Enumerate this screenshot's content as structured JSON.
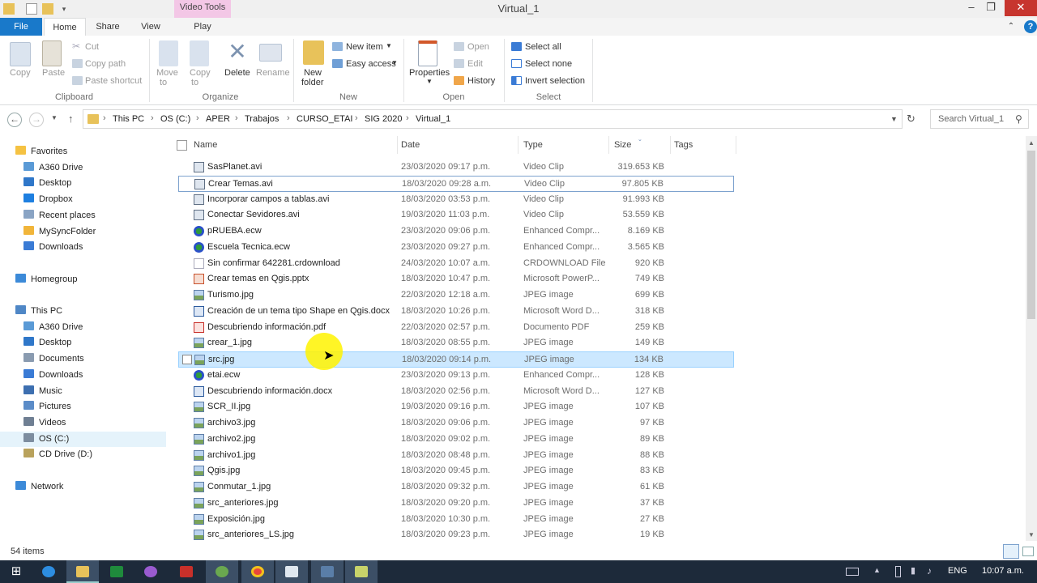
{
  "window": {
    "title": "Virtual_1",
    "context_tab": "Video Tools",
    "min": "–",
    "max": "❐",
    "close": "✕"
  },
  "ribbon_tabs": [
    "File",
    "Home",
    "Share",
    "View",
    "Play"
  ],
  "ribbon": {
    "clipboard": {
      "copy": "Copy",
      "paste": "Paste",
      "cut": "Cut",
      "copy_path": "Copy path",
      "paste_shortcut": "Paste shortcut",
      "group": "Clipboard"
    },
    "organize": {
      "move_to": "Move",
      "move_to2": "to",
      "copy_to": "Copy",
      "copy_to2": "to",
      "delete": "Delete",
      "rename": "Rename",
      "group": "Organize"
    },
    "new": {
      "new_folder": "New",
      "new_folder2": "folder",
      "new_item": "New item",
      "easy_access": "Easy access",
      "group": "New"
    },
    "open": {
      "properties": "Properties",
      "open": "Open",
      "edit": "Edit",
      "history": "History",
      "group": "Open"
    },
    "select": {
      "select_all": "Select all",
      "select_none": "Select none",
      "invert": "Invert selection",
      "group": "Select"
    }
  },
  "address": {
    "crumbs": [
      "This PC",
      "OS (C:)",
      "APER",
      "Trabajos",
      "CURSO_ETAI",
      "SIG 2020",
      "Virtual_1"
    ],
    "search_placeholder": "Search Virtual_1"
  },
  "nav": [
    {
      "label": "Favorites",
      "indent": 0,
      "icon": "star-icon",
      "color": "#f5c242"
    },
    {
      "label": "A360 Drive",
      "indent": 1,
      "icon": "cloud-icon",
      "color": "#5a9ad6"
    },
    {
      "label": "Desktop",
      "indent": 1,
      "icon": "desktop-icon",
      "color": "#2f77c9"
    },
    {
      "label": "Dropbox",
      "indent": 1,
      "icon": "dropbox-icon",
      "color": "#1e7fe0"
    },
    {
      "label": "Recent places",
      "indent": 1,
      "icon": "recent-icon",
      "color": "#8aa4c4"
    },
    {
      "label": "MySyncFolder",
      "indent": 1,
      "icon": "sync-icon",
      "color": "#f1b53a"
    },
    {
      "label": "Downloads",
      "indent": 1,
      "icon": "downloads-icon",
      "color": "#3a7bd5"
    },
    {
      "label": "",
      "indent": 0,
      "icon": "",
      "color": ""
    },
    {
      "label": "Homegroup",
      "indent": 0,
      "icon": "homegroup-icon",
      "color": "#3c8ad8"
    },
    {
      "label": "",
      "indent": 0,
      "icon": "",
      "color": ""
    },
    {
      "label": "This PC",
      "indent": 0,
      "icon": "computer-icon",
      "color": "#4f87c6"
    },
    {
      "label": "A360 Drive",
      "indent": 1,
      "icon": "cloud-icon",
      "color": "#5a9ad6"
    },
    {
      "label": "Desktop",
      "indent": 1,
      "icon": "desktop-icon",
      "color": "#2f77c9"
    },
    {
      "label": "Documents",
      "indent": 1,
      "icon": "documents-icon",
      "color": "#8a9bb0"
    },
    {
      "label": "Downloads",
      "indent": 1,
      "icon": "downloads-icon",
      "color": "#3a7bd5"
    },
    {
      "label": "Music",
      "indent": 1,
      "icon": "music-icon",
      "color": "#3d6fb0"
    },
    {
      "label": "Pictures",
      "indent": 1,
      "icon": "pictures-icon",
      "color": "#5b8cc8"
    },
    {
      "label": "Videos",
      "indent": 1,
      "icon": "videos-icon",
      "color": "#6f7f93"
    },
    {
      "label": "OS (C:)",
      "indent": 1,
      "icon": "drive-icon",
      "color": "#7d8d9f",
      "selected": true
    },
    {
      "label": "CD Drive (D:)",
      "indent": 1,
      "icon": "cd-icon",
      "color": "#b9a25c"
    },
    {
      "label": "",
      "indent": 0,
      "icon": "",
      "color": ""
    },
    {
      "label": "Network",
      "indent": 0,
      "icon": "network-icon",
      "color": "#3c8ad8"
    }
  ],
  "columns": {
    "name": "Name",
    "date": "Date",
    "type": "Type",
    "size": "Size",
    "tags": "Tags"
  },
  "files": [
    {
      "name": "SasPlanet.avi",
      "date": "23/03/2020 09:17 p.m.",
      "type": "Video Clip",
      "size": "319.653 KB",
      "icon": "video-icon"
    },
    {
      "name": "Crear Temas.avi",
      "date": "18/03/2020 09:28 a.m.",
      "type": "Video Clip",
      "size": "97.805 KB",
      "icon": "video-icon",
      "state": "focus"
    },
    {
      "name": "Incorporar campos a tablas.avi",
      "date": "18/03/2020 03:53 p.m.",
      "type": "Video Clip",
      "size": "91.993 KB",
      "icon": "video-icon"
    },
    {
      "name": "Conectar Sevidores.avi",
      "date": "19/03/2020 11:03 p.m.",
      "type": "Video Clip",
      "size": "53.559 KB",
      "icon": "video-icon"
    },
    {
      "name": "pRUEBA.ecw",
      "date": "23/03/2020 09:06 p.m.",
      "type": "Enhanced Compr...",
      "size": "8.169 KB",
      "icon": "ecw-icon"
    },
    {
      "name": "Escuela Tecnica.ecw",
      "date": "23/03/2020 09:27 p.m.",
      "type": "Enhanced Compr...",
      "size": "3.565 KB",
      "icon": "ecw-icon"
    },
    {
      "name": "Sin confirmar 642281.crdownload",
      "date": "24/03/2020 10:07 a.m.",
      "type": "CRDOWNLOAD File",
      "size": "920 KB",
      "icon": "blank-file-icon"
    },
    {
      "name": "Crear temas en Qgis.pptx",
      "date": "18/03/2020 10:47 p.m.",
      "type": "Microsoft PowerP...",
      "size": "749 KB",
      "icon": "pptx-icon"
    },
    {
      "name": "Turismo.jpg",
      "date": "22/03/2020 12:18 a.m.",
      "type": "JPEG image",
      "size": "699 KB",
      "icon": "image-icon"
    },
    {
      "name": "Creación de un tema tipo Shape en Qgis.docx",
      "date": "18/03/2020 10:26 p.m.",
      "type": "Microsoft Word D...",
      "size": "318 KB",
      "icon": "docx-icon"
    },
    {
      "name": "Descubriendo información.pdf",
      "date": "22/03/2020 02:57 p.m.",
      "type": "Documento PDF",
      "size": "259 KB",
      "icon": "pdf-icon"
    },
    {
      "name": "crear_1.jpg",
      "date": "18/03/2020 08:55 p.m.",
      "type": "JPEG image",
      "size": "149 KB",
      "icon": "image-icon"
    },
    {
      "name": "src.jpg",
      "date": "18/03/2020 09:14 p.m.",
      "type": "JPEG image",
      "size": "134 KB",
      "icon": "image-icon",
      "state": "selected"
    },
    {
      "name": "etai.ecw",
      "date": "23/03/2020 09:13 p.m.",
      "type": "Enhanced Compr...",
      "size": "128 KB",
      "icon": "ecw-icon"
    },
    {
      "name": "Descubriendo información.docx",
      "date": "18/03/2020 02:56 p.m.",
      "type": "Microsoft Word D...",
      "size": "127 KB",
      "icon": "docx-icon"
    },
    {
      "name": "SCR_II.jpg",
      "date": "19/03/2020 09:16 p.m.",
      "type": "JPEG image",
      "size": "107 KB",
      "icon": "image-icon"
    },
    {
      "name": "archivo3.jpg",
      "date": "18/03/2020 09:06 p.m.",
      "type": "JPEG image",
      "size": "97 KB",
      "icon": "image-icon"
    },
    {
      "name": "archivo2.jpg",
      "date": "18/03/2020 09:02 p.m.",
      "type": "JPEG image",
      "size": "89 KB",
      "icon": "image-icon"
    },
    {
      "name": "archivo1.jpg",
      "date": "18/03/2020 08:48 p.m.",
      "type": "JPEG image",
      "size": "88 KB",
      "icon": "image-icon"
    },
    {
      "name": "Qgis.jpg",
      "date": "18/03/2020 09:45 p.m.",
      "type": "JPEG image",
      "size": "83 KB",
      "icon": "image-icon"
    },
    {
      "name": "Conmutar_1.jpg",
      "date": "18/03/2020 09:32 p.m.",
      "type": "JPEG image",
      "size": "61 KB",
      "icon": "image-icon"
    },
    {
      "name": "src_anteriores.jpg",
      "date": "18/03/2020 09:20 p.m.",
      "type": "JPEG image",
      "size": "37 KB",
      "icon": "image-icon"
    },
    {
      "name": "Exposición.jpg",
      "date": "18/03/2020 10:30 p.m.",
      "type": "JPEG image",
      "size": "27 KB",
      "icon": "image-icon"
    },
    {
      "name": "src_anteriores_LS.jpg",
      "date": "18/03/2020 09:23 p.m.",
      "type": "JPEG image",
      "size": "19 KB",
      "icon": "image-icon"
    }
  ],
  "status": {
    "count": "54 items"
  },
  "taskbar": {
    "lang": "ENG",
    "clock": "10:07 a.m."
  },
  "colors": {
    "accent": "#1979ca",
    "selection": "#cce8ff",
    "context_tab": "#f3c7e6"
  }
}
